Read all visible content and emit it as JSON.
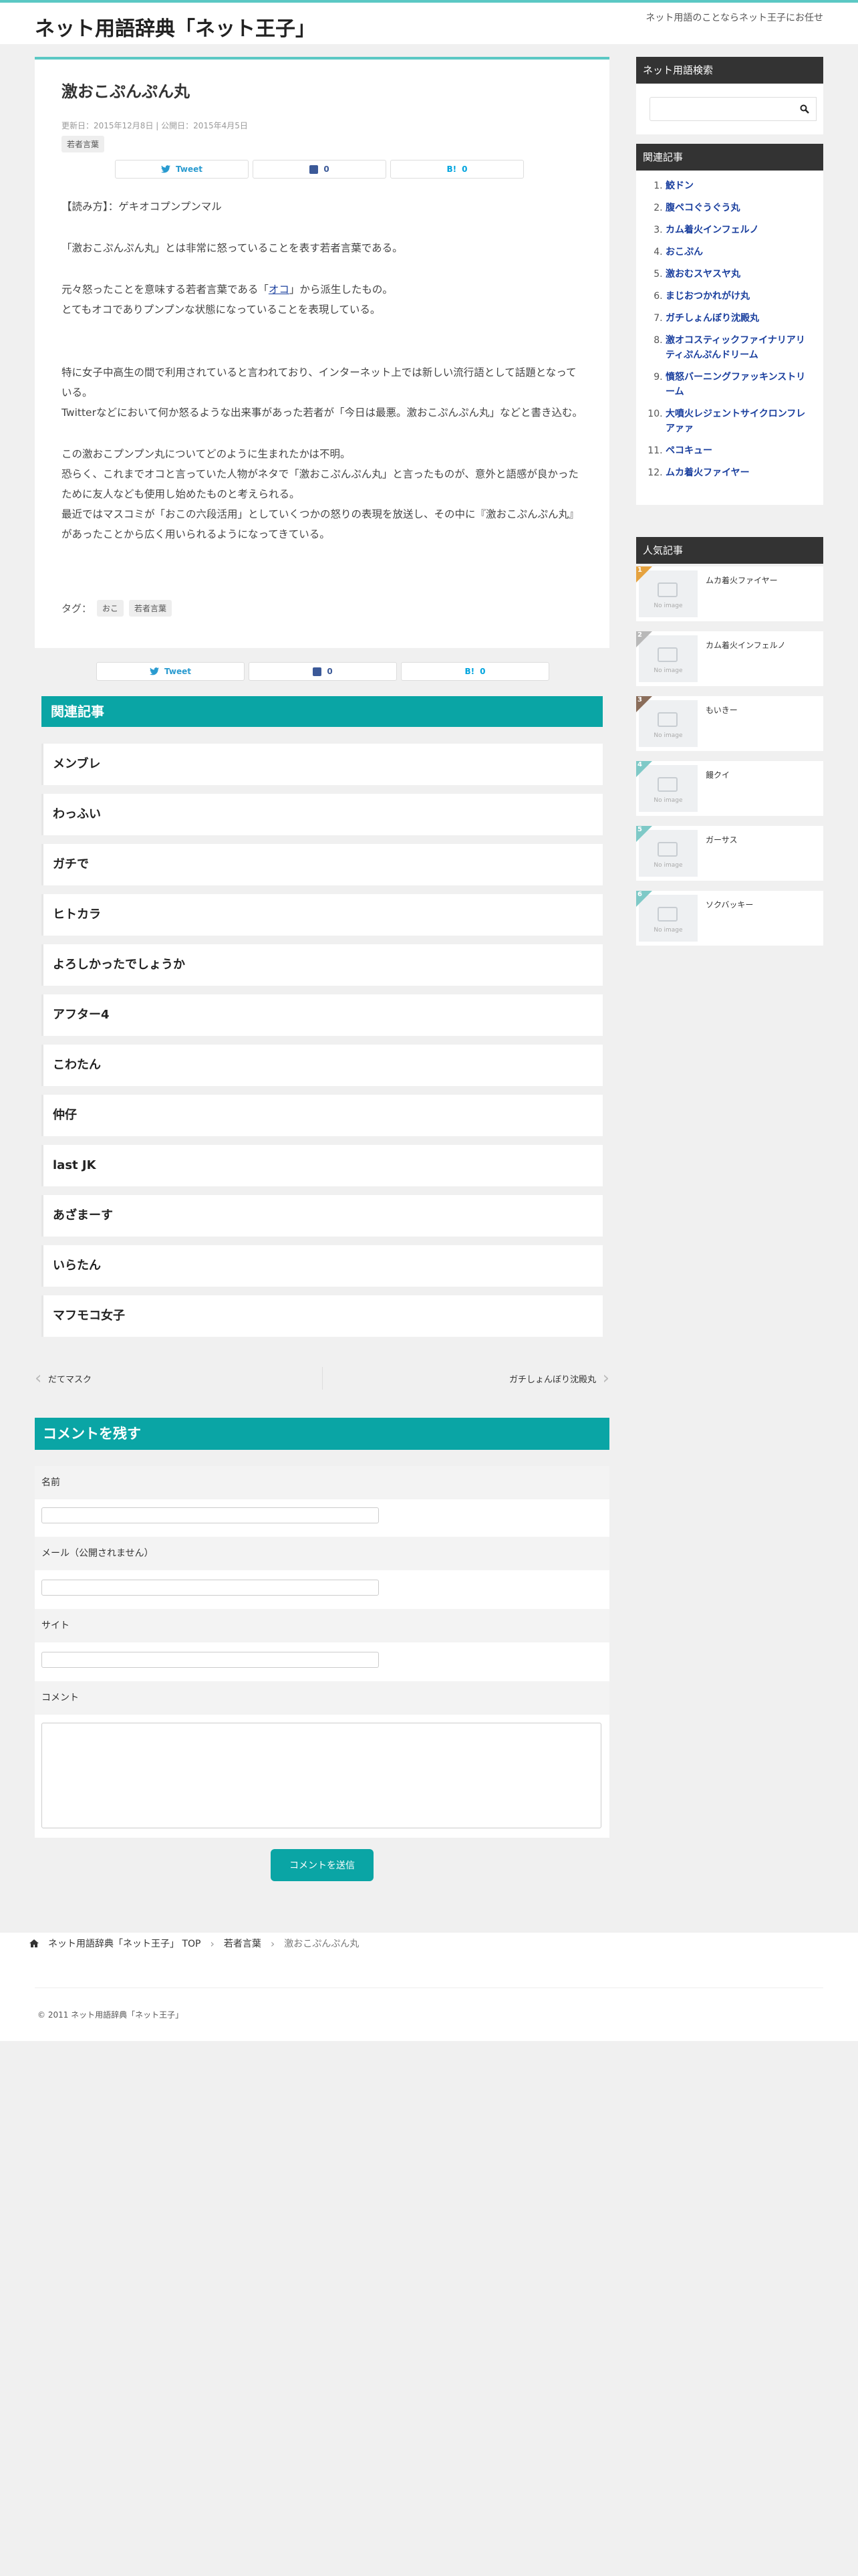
{
  "header": {
    "site_title": "ネット用語辞典「ネット王子」",
    "tagline": "ネット用語のことならネット王子にお任せ"
  },
  "article": {
    "title": "激おこぷんぷん丸",
    "date": "更新日：2015年12月8日 | 公開日：2015年4月5日",
    "category": "若者言葉",
    "share": {
      "tweet": "Tweet",
      "fb_count": "0",
      "hb_count": "0"
    },
    "paragraphs": [
      "【読み方】：ゲキオコプンプンマル",
      "「激おこぷんぷん丸」とは非常に怒っていることを表す若者言葉である。",
      "元々怒ったことを意味する若者言葉である「",
      "オコ",
      "」から派生したもの。",
      "とてもオコでありプンプンな状態になっていることを表現している。",
      "特に女子中高生の間で利用されていると言われており、インターネット上では新しい流行語として話題となっている。",
      "Twitterなどにおいて何か怒るような出来事があった若者が「今日は最悪。激おこぷんぷん丸」などと書き込む。",
      "この激おこプンプン丸についてどのように生まれたかは不明。",
      "恐らく、これまでオコと言っていた人物がネタで「激おこぷんぷん丸」と言ったものが、意外と語感が良かったために友人なども使用し始めたものと考えられる。",
      "最近ではマスコミが「おこの六段活用」としていくつかの怒りの表現を放送し、その中に『激おこぷんぷん丸』があったことから広く用いられるようになってきている。"
    ],
    "tags_label": "タグ：",
    "tags": [
      "おこ",
      "若者言葉"
    ]
  },
  "related": {
    "heading": "関連記事",
    "items": [
      "メンブレ",
      "わっふい",
      "ガチで",
      "ヒトカラ",
      "よろしかったでしょうか",
      "アフター4",
      "こわたん",
      "仲仔",
      "last JK",
      "あざまーす",
      "いらたん",
      "マフモコ女子"
    ]
  },
  "pager": {
    "prev": "だてマスク",
    "next": "ガチしょんぼり沈殿丸"
  },
  "comments": {
    "heading": "コメントを残す",
    "name_label": "名前",
    "email_label": "メール（公開されません）",
    "site_label": "サイト",
    "comment_label": "コメント",
    "submit_label": "コメントを送信"
  },
  "breadcrumb": {
    "home": "ネット用語辞典「ネット王子」 TOP",
    "category": "若者言葉",
    "current": "激おこぷんぷん丸"
  },
  "footer": {
    "copyright": "© 2011 ネット用語辞典「ネット王子」"
  },
  "sidebar": {
    "search_heading": "ネット用語検索",
    "keywords_heading": "関連記事",
    "keywords": [
      "鮫ドン",
      "腹ペコぐうぐう丸",
      "カム着火インフェルノ",
      "おこぷん",
      "激おむスヤスヤ丸",
      "まじおつかれがけ丸",
      "ガチしょんぼり沈殿丸",
      "激オコスティックファイナリアリティぷんぷんドリーム",
      "憤怒バーニングファッキンストリーム",
      "大噴火レジェントサイクロンフレアァァ",
      "ペコキュー",
      "ムカ着火ファイヤー"
    ],
    "popular_heading": "人気記事",
    "no_image": "No image",
    "popular": [
      {
        "rank": "1",
        "title": "ムカ着火ファイヤー",
        "color": "#e5a23f"
      },
      {
        "rank": "2",
        "title": "カム着火インフェルノ",
        "color": "#b8b8b8"
      },
      {
        "rank": "3",
        "title": "もいきー",
        "color": "#8a6d5a"
      },
      {
        "rank": "4",
        "title": "饅クイ",
        "color": "#7ec9c7"
      },
      {
        "rank": "5",
        "title": "ガーサス",
        "color": "#7ec9c7"
      },
      {
        "rank": "6",
        "title": "ソクバッキー",
        "color": "#7ec9c7"
      }
    ]
  },
  "colors": {
    "accent": "#0aa5a5",
    "topline": "#5bc8c4",
    "sidebar_head": "#333333"
  }
}
